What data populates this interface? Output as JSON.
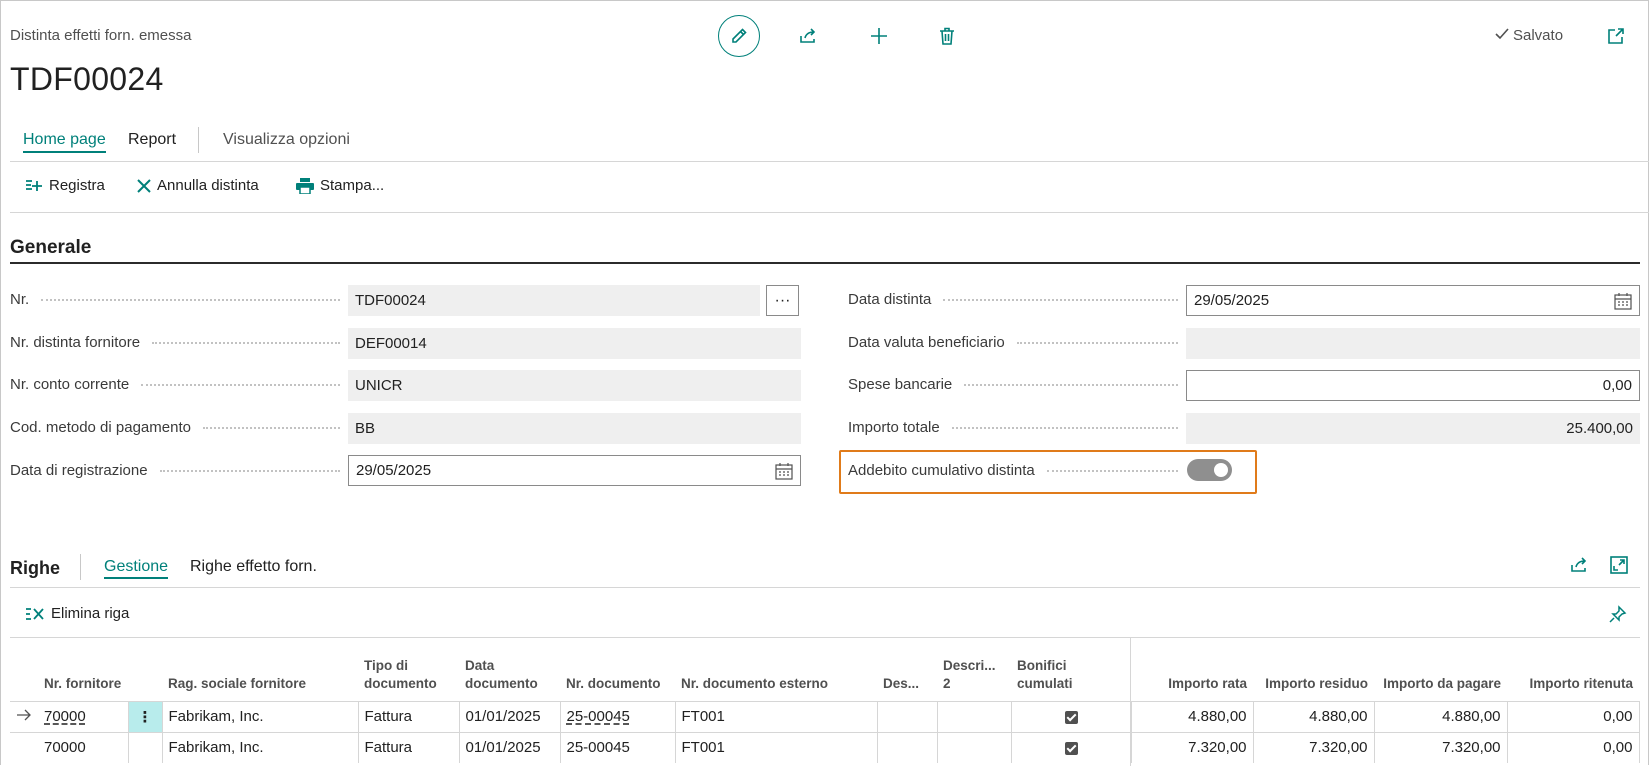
{
  "header": {
    "caption": "Distinta effetti forn. emessa",
    "title": "TDF00024",
    "status": "Salvato",
    "icons": [
      "pencil-icon",
      "share-icon",
      "plus-icon",
      "trash-icon",
      "popout-icon"
    ]
  },
  "tabs": {
    "home": "Home page",
    "report": "Report",
    "options": "Visualizza opzioni"
  },
  "actions": {
    "post": "Registra",
    "cancel": "Annulla distinta",
    "print": "Stampa..."
  },
  "general": {
    "title": "Generale",
    "left": {
      "nr_label": "Nr.",
      "nr_value": "TDF00024",
      "vendor_bill_label": "Nr. distinta fornitore",
      "vendor_bill_value": "DEF00014",
      "bank_label": "Nr. conto corrente",
      "bank_value": "UNICR",
      "payment_method_label": "Cod. metodo di pagamento",
      "payment_method_value": "BB",
      "posting_date_label": "Data di registrazione",
      "posting_date_value": "29/05/2025"
    },
    "right": {
      "list_date_label": "Data distinta",
      "list_date_value": "29/05/2025",
      "beneficiary_value_date_label": "Data valuta beneficiario",
      "beneficiary_value_date_value": "",
      "bank_expense_label": "Spese bancarie",
      "bank_expense_value": "0,00",
      "total_amount_label": "Importo totale",
      "total_amount_value": "25.400,00",
      "cumulative_label": "Addebito cumulativo distinta",
      "cumulative_on": true
    }
  },
  "lines": {
    "title": "Righe",
    "tab_manage": "Gestione",
    "tab_lines": "Righe effetto forn.",
    "delete_line": "Elimina riga",
    "columns": {
      "vendor_nr": "Nr. fornitore",
      "vendor_name": "Rag. sociale fornitore",
      "doc_type": "Tipo di documento",
      "doc_date": "Data documento",
      "doc_nr": "Nr. documento",
      "ext_doc_nr": "Nr. documento esterno",
      "desc": "Des...",
      "desc2": "Descri... 2",
      "cumulative": "Bonifici cumulati",
      "installment": "Importo rata",
      "remaining": "Importo residuo",
      "to_pay": "Importo da pagare",
      "withholding": "Importo ritenuta"
    },
    "rows": [
      {
        "vendor_nr": "70000",
        "vendor_name": "Fabrikam, Inc.",
        "doc_type": "Fattura",
        "doc_date": "01/01/2025",
        "doc_nr": "25-00045",
        "ext_doc_nr": "FT001",
        "cumulative": true,
        "installment": "4.880,00",
        "remaining": "4.880,00",
        "to_pay": "4.880,00",
        "withholding": "0,00"
      },
      {
        "vendor_nr": "70000",
        "vendor_name": "Fabrikam, Inc.",
        "doc_type": "Fattura",
        "doc_date": "01/01/2025",
        "doc_nr": "25-00045",
        "ext_doc_nr": "FT001",
        "cumulative": true,
        "installment": "7.320,00",
        "remaining": "7.320,00",
        "to_pay": "7.320,00",
        "withholding": "0,00"
      }
    ]
  },
  "colors": {
    "accent": "#00807a",
    "highlight": "#e07b1a"
  }
}
